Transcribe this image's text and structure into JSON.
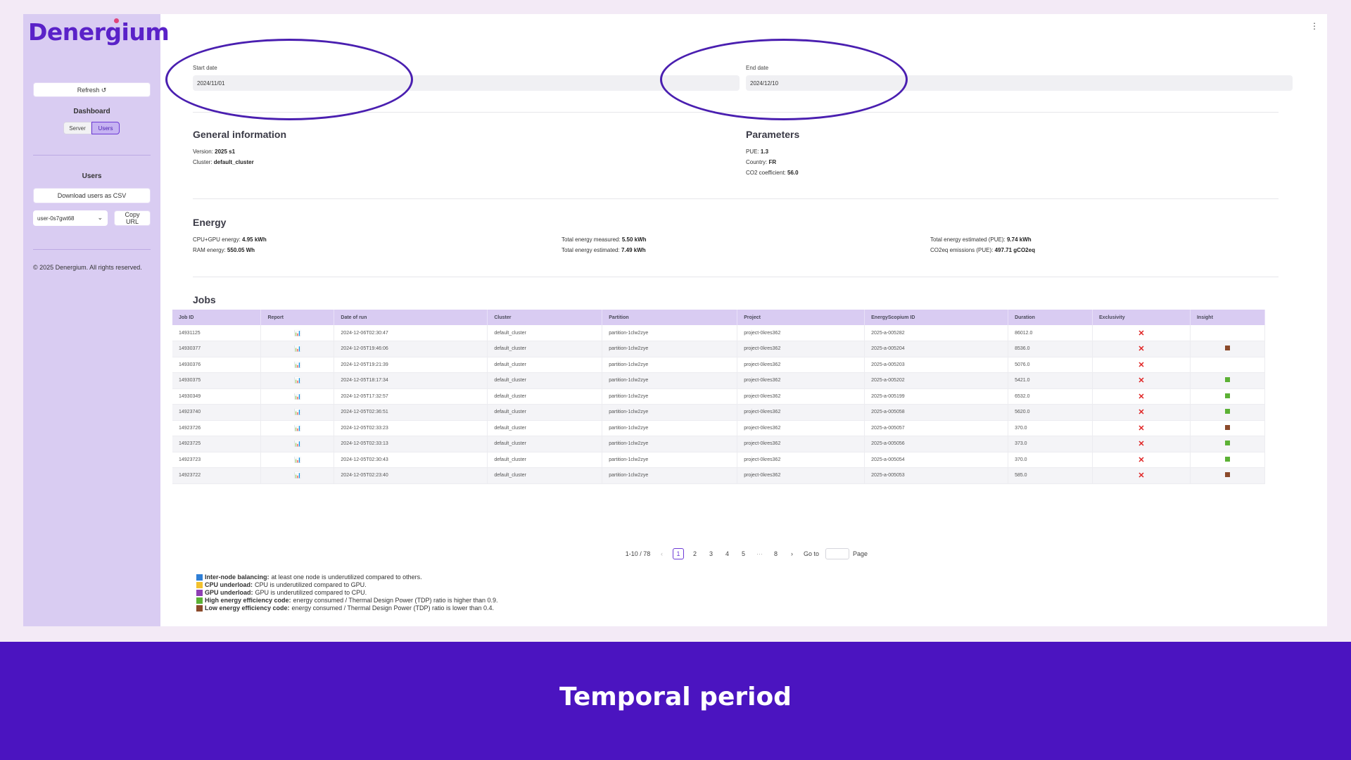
{
  "sidebar": {
    "logo": "Denergium",
    "refresh_label": "Refresh ↺",
    "dashboard_title": "Dashboard",
    "toggle": {
      "server": "Server",
      "users": "Users"
    },
    "users_title": "Users",
    "download_label": "Download users as CSV",
    "user_select_value": "user-0s7gwt68",
    "copy_url_label": "Copy URL",
    "copyright": "© 2025 Denergium. All rights reserved."
  },
  "dates": {
    "start_label": "Start date",
    "start_value": "2024/11/01",
    "end_label": "End date",
    "end_value": "2024/12/10"
  },
  "general": {
    "title": "General information",
    "version_label": "Version:",
    "version_value": "2025 s1",
    "cluster_label": "Cluster:",
    "cluster_value": "default_cluster"
  },
  "parameters": {
    "title": "Parameters",
    "pue_label": "PUE:",
    "pue_value": "1.3",
    "country_label": "Country:",
    "country_value": "FR",
    "co2_label": "CO2 coefficient:",
    "co2_value": "56.0"
  },
  "energy": {
    "title": "Energy",
    "cpu_gpu_label": "CPU+GPU energy:",
    "cpu_gpu_value": "4.95 kWh",
    "ram_label": "RAM energy:",
    "ram_value": "550.05 Wh",
    "total_measured_label": "Total energy measured:",
    "total_measured_value": "5.50 kWh",
    "total_estimated_label": "Total energy estimated:",
    "total_estimated_value": "7.49 kWh",
    "total_pue_label": "Total energy estimated (PUE):",
    "total_pue_value": "9.74 kWh",
    "co2_label": "CO2eq emissions (PUE):",
    "co2_value": "497.71 gCO2eq"
  },
  "jobs": {
    "title": "Jobs",
    "columns": [
      "Job ID",
      "Report",
      "Date of run",
      "Cluster",
      "Partition",
      "Project",
      "EnergyScopium ID",
      "Duration",
      "Exclusivity",
      "Insight"
    ],
    "report_icon": "📊",
    "exclusivity_mark": "✕",
    "rows": [
      {
        "id": "14931125",
        "date": "2024-12-06T02:30:47",
        "cluster": "default_cluster",
        "partition": "partition-1clw2zye",
        "project": "project-0kres362",
        "escope": "2025-a-005282",
        "duration": "86012.0",
        "insight": ""
      },
      {
        "id": "14930377",
        "date": "2024-12-05T19:46:06",
        "cluster": "default_cluster",
        "partition": "partition-1clw2zye",
        "project": "project-0kres362",
        "escope": "2025-a-005204",
        "duration": "8536.0",
        "insight": "#8b4a2b"
      },
      {
        "id": "14930376",
        "date": "2024-12-05T19:21:39",
        "cluster": "default_cluster",
        "partition": "partition-1clw2zye",
        "project": "project-0kres362",
        "escope": "2025-a-005203",
        "duration": "5076.0",
        "insight": ""
      },
      {
        "id": "14930375",
        "date": "2024-12-05T18:17:34",
        "cluster": "default_cluster",
        "partition": "partition-1clw2zye",
        "project": "project-0kres362",
        "escope": "2025-a-005202",
        "duration": "5421.0",
        "insight": "#5cb135"
      },
      {
        "id": "14930349",
        "date": "2024-12-05T17:32:57",
        "cluster": "default_cluster",
        "partition": "partition-1clw2zye",
        "project": "project-0kres362",
        "escope": "2025-a-005199",
        "duration": "6532.0",
        "insight": "#5cb135"
      },
      {
        "id": "14923740",
        "date": "2024-12-05T02:36:51",
        "cluster": "default_cluster",
        "partition": "partition-1clw2zye",
        "project": "project-0kres362",
        "escope": "2025-a-005058",
        "duration": "5620.0",
        "insight": "#5cb135"
      },
      {
        "id": "14923726",
        "date": "2024-12-05T02:33:23",
        "cluster": "default_cluster",
        "partition": "partition-1clw2zye",
        "project": "project-0kres362",
        "escope": "2025-a-005057",
        "duration": "370.0",
        "insight": "#8b4a2b"
      },
      {
        "id": "14923725",
        "date": "2024-12-05T02:33:13",
        "cluster": "default_cluster",
        "partition": "partition-1clw2zye",
        "project": "project-0kres362",
        "escope": "2025-a-005056",
        "duration": "373.0",
        "insight": "#5cb135"
      },
      {
        "id": "14923723",
        "date": "2024-12-05T02:30:43",
        "cluster": "default_cluster",
        "partition": "partition-1clw2zye",
        "project": "project-0kres362",
        "escope": "2025-a-005054",
        "duration": "370.0",
        "insight": "#5cb135"
      },
      {
        "id": "14923722",
        "date": "2024-12-05T02:23:40",
        "cluster": "default_cluster",
        "partition": "partition-1clw2zye",
        "project": "project-0kres362",
        "escope": "2025-a-005053",
        "duration": "585.0",
        "insight": "#8b4a2b"
      }
    ]
  },
  "pagination": {
    "range": "1-10 / 78",
    "prev": "‹",
    "next": "›",
    "pages": [
      "1",
      "2",
      "3",
      "4",
      "5"
    ],
    "ellipsis": "···",
    "last": "8",
    "goto_label": "Go to",
    "page_label": "Page"
  },
  "legend": [
    {
      "color": "#2f7fd6",
      "title": "Inter-node balancing:",
      "text": "at least one node is underutilized compared to others."
    },
    {
      "color": "#f2c12e",
      "title": "CPU underload:",
      "text": "CPU is underutilized compared to GPU."
    },
    {
      "color": "#8e3fb3",
      "title": "GPU underload:",
      "text": "GPU is underutilized compared to CPU."
    },
    {
      "color": "#5cb135",
      "title": "High energy efficiency code:",
      "text": "energy consumed / Thermal Design Power (TDP) ratio is higher than 0.9."
    },
    {
      "color": "#8b4a2b",
      "title": "Low energy efficiency code:",
      "text": "energy consumed / Thermal Design Power (TDP) ratio is lower than 0.4."
    }
  ],
  "banner": {
    "title": "Temporal period"
  },
  "colors": {
    "accent": "#4b14c0",
    "sidebar": "#d9ccf2",
    "highlight": "#4a1fb0"
  }
}
